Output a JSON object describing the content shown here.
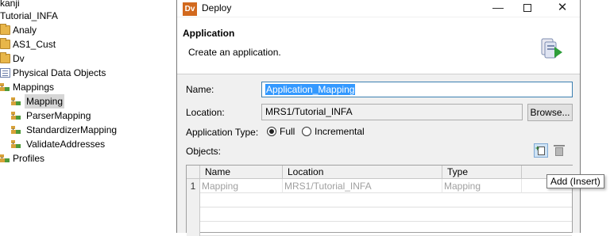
{
  "tree": {
    "items": [
      {
        "label": "kanji"
      },
      {
        "label": "Tutorial_INFA"
      },
      {
        "label": "Analy"
      },
      {
        "label": "AS1_Cust"
      },
      {
        "label": "Dv"
      },
      {
        "label": "Physical Data Objects"
      },
      {
        "label": "Mappings"
      },
      {
        "label": "Mapping"
      },
      {
        "label": "ParserMapping"
      },
      {
        "label": "StandardizerMapping"
      },
      {
        "label": "ValidateAddresses"
      },
      {
        "label": "Profiles"
      }
    ]
  },
  "dialog": {
    "badge": "Dv",
    "title": "Deploy",
    "header_title": "Application",
    "header_subtitle": "Create an application.",
    "name_label": "Name:",
    "name_value": "Application_Mapping",
    "location_label": "Location:",
    "location_value": "MRS1/Tutorial_INFA",
    "browse_label": "Browse...",
    "app_type_label": "Application Type:",
    "app_type_options": [
      "Full",
      "Incremental"
    ],
    "app_type_selected": "Full",
    "objects_label": "Objects:",
    "table": {
      "columns": [
        "Name",
        "Location",
        "Type"
      ],
      "rows": [
        {
          "num": "1",
          "name": "Mapping",
          "location": "MRS1/Tutorial_INFA",
          "type": "Mapping"
        }
      ]
    },
    "tooltip": "Add (Insert)"
  }
}
